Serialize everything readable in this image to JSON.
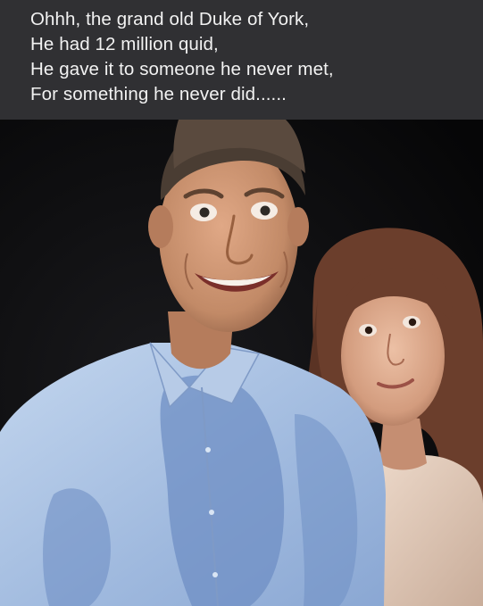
{
  "caption": {
    "lines": [
      "Ohhh, the grand old Duke of York,",
      "He had 12 million quid,",
      "He gave it to someone he never met,",
      "For something he never did......"
    ]
  },
  "photo": {
    "colors": {
      "background": "#0b0b0d",
      "shirt": "#a9c2e2",
      "shirt_stain": "#6f8fc4",
      "skin_man": "#c8906e",
      "skin_woman": "#d9a88c",
      "hair_man": "#4a3d33",
      "hair_woman": "#6b3e2c",
      "top_woman": "#e3cdbd"
    }
  }
}
